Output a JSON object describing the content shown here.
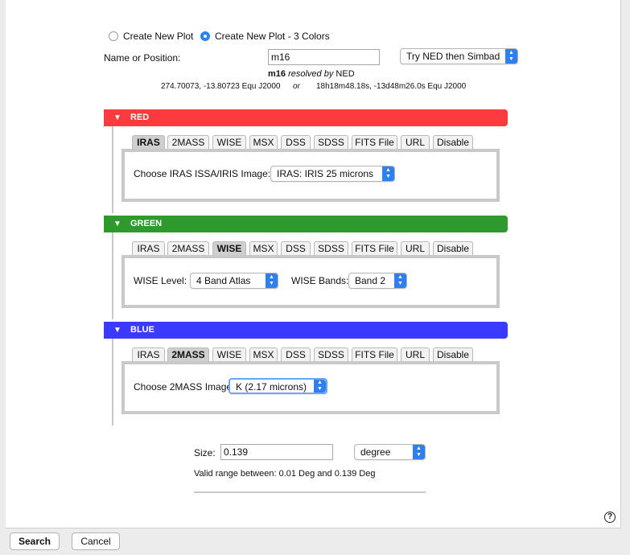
{
  "plot_type": {
    "option_new": "Create New Plot",
    "option_3color": "Create New Plot - 3 Colors",
    "selected": "Create New Plot - 3 Colors"
  },
  "target": {
    "label": "Name or Position:",
    "value": "m16",
    "resolver": "Try NED then Simbad",
    "resolved_name": "m16",
    "resolved_by_text": "resolved by",
    "resolved_source": "NED",
    "coords_decimal": "274.70073, -13.80723  Equ J2000",
    "or_text": "or",
    "coords_sexagesimal": "18h18m48.18s, -13d48m26.0s  Equ J2000"
  },
  "tabs": [
    "IRAS",
    "2MASS",
    "WISE",
    "MSX",
    "DSS",
    "SDSS",
    "FITS File",
    "URL",
    "Disable"
  ],
  "red": {
    "title": "RED",
    "color": "#fb3b40",
    "active_tab": "IRAS",
    "field_label": "Choose IRAS ISSA/IRIS Image:",
    "field_value": "IRAS: IRIS 25 microns"
  },
  "green": {
    "title": "GREEN",
    "color": "#2e9a2e",
    "active_tab": "WISE",
    "level_label": "WISE Level:",
    "level_value": "4 Band Atlas",
    "bands_label": "WISE Bands:",
    "bands_value": "Band 2"
  },
  "blue": {
    "title": "BLUE",
    "color": "#3b3bff",
    "active_tab": "2MASS",
    "field_label": "Choose 2MASS Image:",
    "field_value": "K (2.17 microns)"
  },
  "size": {
    "label": "Size:",
    "value": "0.139",
    "unit": "degree",
    "valid_range": "Valid range between: 0.01 Deg and 0.139 Deg"
  },
  "footer": {
    "search_label": "Search",
    "cancel_label": "Cancel",
    "help_glyph": "?"
  },
  "icons": {
    "collapse": "triangle-down-icon",
    "select": "chevron-updown-icon",
    "help": "question-circle-icon"
  }
}
